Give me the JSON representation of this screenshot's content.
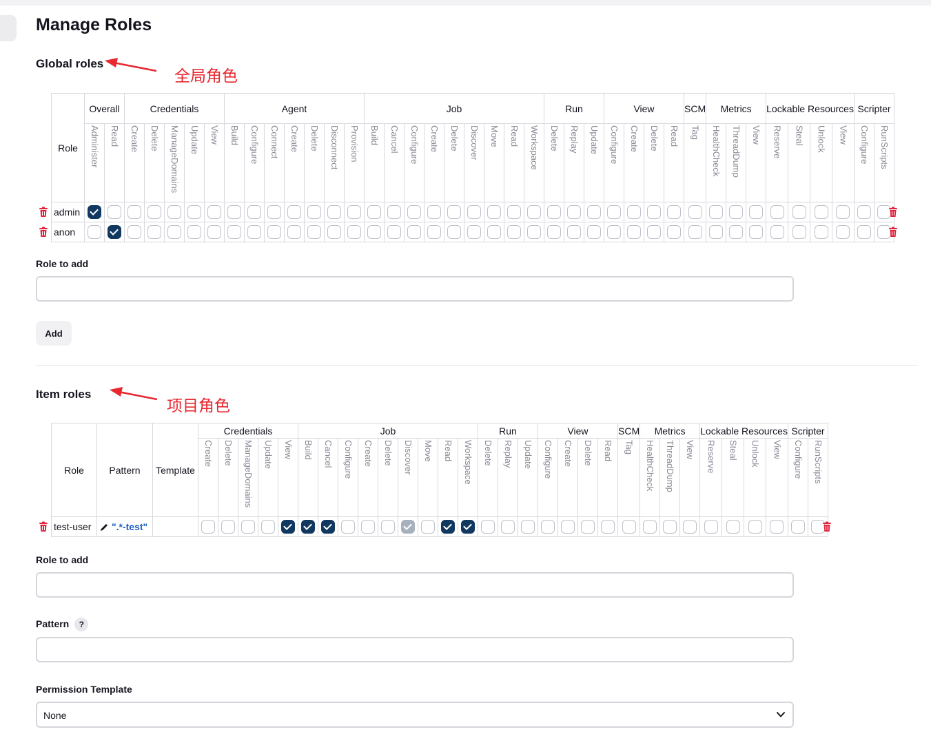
{
  "page": {
    "title": "Manage Roles"
  },
  "global": {
    "title": "Global roles",
    "annotation": "全局角色",
    "role_header": "Role",
    "groups": [
      {
        "name": "Overall",
        "perms": [
          "Administer",
          "Read"
        ]
      },
      {
        "name": "Credentials",
        "perms": [
          "Create",
          "Delete",
          "ManageDomains",
          "Update",
          "View"
        ]
      },
      {
        "name": "Agent",
        "perms": [
          "Build",
          "Configure",
          "Connect",
          "Create",
          "Delete",
          "Disconnect",
          "Provision"
        ]
      },
      {
        "name": "Job",
        "perms": [
          "Build",
          "Cancel",
          "Configure",
          "Create",
          "Delete",
          "Discover",
          "Move",
          "Read",
          "Workspace"
        ]
      },
      {
        "name": "Run",
        "perms": [
          "Delete",
          "Replay",
          "Update"
        ]
      },
      {
        "name": "View",
        "perms": [
          "Configure",
          "Create",
          "Delete",
          "Read"
        ]
      },
      {
        "name": "SCM",
        "perms": [
          "Tag"
        ]
      },
      {
        "name": "Metrics",
        "perms": [
          "HealthCheck",
          "ThreadDump",
          "View"
        ]
      },
      {
        "name": "Lockable Resources",
        "perms": [
          "Reserve",
          "Steal",
          "Unlock",
          "View"
        ]
      },
      {
        "name": "Scripter",
        "perms": [
          "Configure",
          "RunScripts"
        ]
      }
    ],
    "rows": [
      {
        "name": "admin",
        "checked": [
          0
        ],
        "disabled": []
      },
      {
        "name": "anon",
        "checked": [
          1
        ],
        "disabled": []
      }
    ],
    "add_label": "Role to add",
    "add_value": "",
    "add_button": "Add"
  },
  "item": {
    "title": "Item roles",
    "annotation": "项目角色",
    "headers": {
      "role": "Role",
      "pattern": "Pattern",
      "template": "Template"
    },
    "groups": [
      {
        "name": "Credentials",
        "perms": [
          "Create",
          "Delete",
          "ManageDomains",
          "Update",
          "View"
        ]
      },
      {
        "name": "Job",
        "perms": [
          "Build",
          "Cancel",
          "Configure",
          "Create",
          "Delete",
          "Discover",
          "Move",
          "Read",
          "Workspace"
        ]
      },
      {
        "name": "Run",
        "perms": [
          "Delete",
          "Replay",
          "Update"
        ]
      },
      {
        "name": "View",
        "perms": [
          "Configure",
          "Create",
          "Delete",
          "Read"
        ]
      },
      {
        "name": "SCM",
        "perms": [
          "Tag"
        ]
      },
      {
        "name": "Metrics",
        "perms": [
          "HealthCheck",
          "ThreadDump",
          "View"
        ]
      },
      {
        "name": "Lockable Resources",
        "perms": [
          "Reserve",
          "Steal",
          "Unlock",
          "View"
        ]
      },
      {
        "name": "Scripter",
        "perms": [
          "Configure",
          "RunScripts"
        ]
      }
    ],
    "rows": [
      {
        "name": "test-user",
        "pattern": "\".*-test\"",
        "template": "",
        "checked": [
          4,
          5,
          6,
          12,
          13
        ],
        "disabled": [
          10
        ]
      }
    ],
    "role_label": "Role to add",
    "role_value": "",
    "pattern_label": "Pattern",
    "pattern_help": "?",
    "pattern_value": "",
    "template_label": "Permission Template",
    "template_value": "None"
  },
  "icons": {
    "delete": "trash-icon",
    "edit": "pencil-icon",
    "dropdown": "chevron-down-icon"
  },
  "colors": {
    "checked": "#11385f",
    "disabled_checked": "#a6b1bd",
    "delete": "#e0263f",
    "annotation": "#e8272f",
    "link": "#1f5fbf"
  }
}
